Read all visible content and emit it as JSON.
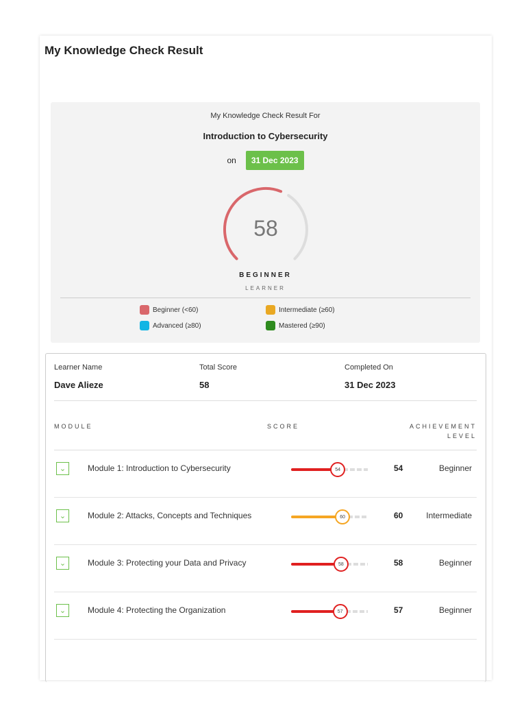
{
  "title": "My Knowledge Check Result",
  "summary": {
    "for_label": "My Knowledge Check Result For",
    "course": "Introduction to Cybersecurity",
    "on_label": "on",
    "date": "31 Dec 2023",
    "score": 58,
    "score_text": "58",
    "level": "BEGINNER",
    "level_sub": "LEARNER"
  },
  "legend": [
    {
      "label": "Beginner (<60)",
      "color": "#d9676b"
    },
    {
      "label": "Intermediate (≥60)",
      "color": "#e9a823"
    },
    {
      "label": "Advanced (≥80)",
      "color": "#11b5e4"
    },
    {
      "label": "Mastered (≥90)",
      "color": "#2e8b1e"
    }
  ],
  "info": {
    "learner_label": "Learner Name",
    "learner": "Dave  Alieze",
    "total_label": "Total Score",
    "total": "58",
    "completed_label": "Completed On",
    "completed": "31 Dec 2023"
  },
  "headers": {
    "module": "MODULE",
    "score": "SCORE",
    "ach1": "ACHIEVEMENT",
    "ach2": "LEVEL"
  },
  "modules": [
    {
      "name": "Module 1: Introduction to Cybersecurity",
      "score": 54,
      "score_text": "54",
      "level": "Beginner",
      "color": "#e02020"
    },
    {
      "name": "Module 2: Attacks, Concepts and Techniques",
      "score": 60,
      "score_text": "60",
      "level": "Intermediate",
      "color": "#f5a623"
    },
    {
      "name": "Module 3: Protecting your Data and Privacy",
      "score": 58,
      "score_text": "58",
      "level": "Beginner",
      "color": "#e02020"
    },
    {
      "name": "Module 4: Protecting the Organization",
      "score": 57,
      "score_text": "57",
      "level": "Beginner",
      "color": "#e02020"
    }
  ]
}
